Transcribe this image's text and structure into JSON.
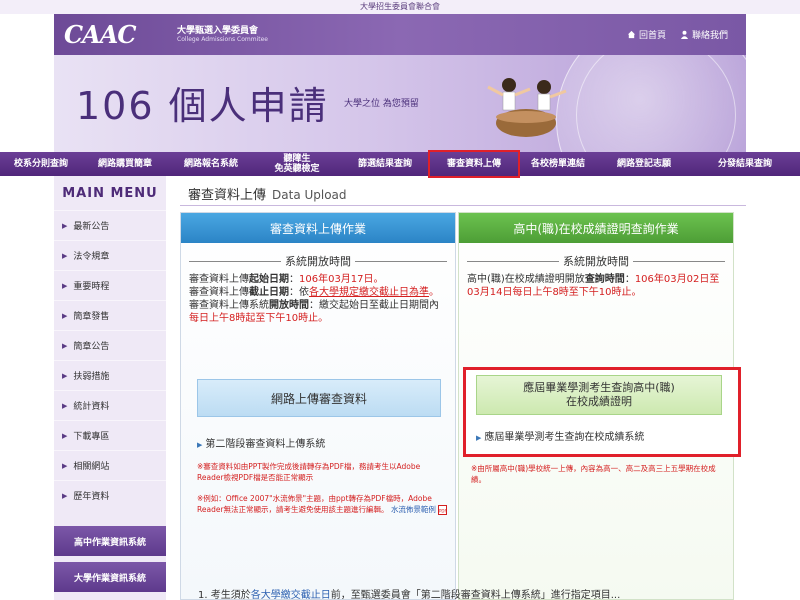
{
  "top_bar": {
    "text": "大學招生委員會聯合會"
  },
  "header": {
    "logo": "CAAC",
    "org_name_zh": "大學甄選入學委員會",
    "org_name_en": "College Admissions Commitee",
    "links": [
      {
        "label": "回首頁",
        "icon": "home-icon"
      },
      {
        "label": "聯絡我們",
        "icon": "person-icon"
      }
    ]
  },
  "banner": {
    "title": "106 個人申請",
    "subtitle": "大學之位 為您預留"
  },
  "nav": {
    "items": [
      {
        "label": "校系分則查詢"
      },
      {
        "label": "網路購買簡章"
      },
      {
        "label": "網路報名系統"
      },
      {
        "label": "聽障生",
        "label2": "免英聽檢定"
      },
      {
        "label": "篩選結果查詢"
      },
      {
        "label": "審查資料上傳",
        "active": true
      },
      {
        "label": "各校榜單連結"
      },
      {
        "label": "網路登記志願"
      },
      {
        "label": "分發結果查詢"
      }
    ]
  },
  "sidebar": {
    "title": "MAIN MENU",
    "items": [
      {
        "label": "最新公告"
      },
      {
        "label": "法令規章"
      },
      {
        "label": "重要時程"
      },
      {
        "label": "簡章發售"
      },
      {
        "label": "簡章公告"
      },
      {
        "label": "扶弱措施"
      },
      {
        "label": "統計資料"
      },
      {
        "label": "下載專區"
      },
      {
        "label": "相關網站"
      },
      {
        "label": "歷年資料"
      }
    ],
    "buttons": [
      {
        "label": "高中作業資訊系統"
      },
      {
        "label": "大學作業資訊系統"
      }
    ]
  },
  "content": {
    "title_zh": "審查資料上傳",
    "title_en": "Data Upload",
    "left": {
      "header": "審查資料上傳作業",
      "section": "系統開放時間",
      "l1a": "審查資料上傳",
      "l1b": "起始日期",
      "l1c": "：",
      "l1d": "106年03月17日。",
      "l2a": "審查資料上傳",
      "l2b": "截止日期",
      "l2c": "：依",
      "l2d": "各大學規定繳交截止日為準",
      "l2e": "。",
      "l3a": "審查資料上傳系統",
      "l3b": "開放時間",
      "l3c": "：繳交起始日至截止日期間內",
      "l3d": "每日上午8時起至下午10時止。",
      "box": "網路上傳審查資料",
      "link": "第二階段審查資料上傳系統",
      "note1": "※審查資料如由PPT製作完成後請轉存為PDF檔，務請考生以Adobe Reader檢視PDF檔是否能正常顯示",
      "note2a": "※例如：Office 2007\"水流佈景\"主題，由ppt轉存為PDF檔時，Adobe Reader無法正常顯示，請考生避免使用該主題進行編輯。",
      "note2b": "水流佈景範例"
    },
    "right": {
      "header": "高中(職)在校成績證明查詢作業",
      "section": "系統開放時間",
      "l1a": "高中(職)在校成績證明開放",
      "l1b": "查詢時間",
      "l1c": "：",
      "l1d": "106年03月02日至03月14日每日上午8時至下午10時止。",
      "box_line1": "應屆畢業學測考生查詢高中(職)",
      "box_line2": "在校成績證明",
      "link": "應屆畢業學測考生查詢在校成績系統",
      "note": "※由所屬高中(職)學校統一上傳，內容為高一、高二及高三上五學期在校成績。"
    },
    "bottom": {
      "prefix": "1. 考生須於",
      "link": "各大學繳交截止日",
      "suffix": "前，至甄選委員會「第二階段審查資料上傳系統」進行指定項目..."
    }
  },
  "colors": {
    "purple_dark": "#50277a",
    "blue_header": "#2b84c6",
    "green_header": "#4d9e36",
    "highlight_red": "#e0202a"
  }
}
